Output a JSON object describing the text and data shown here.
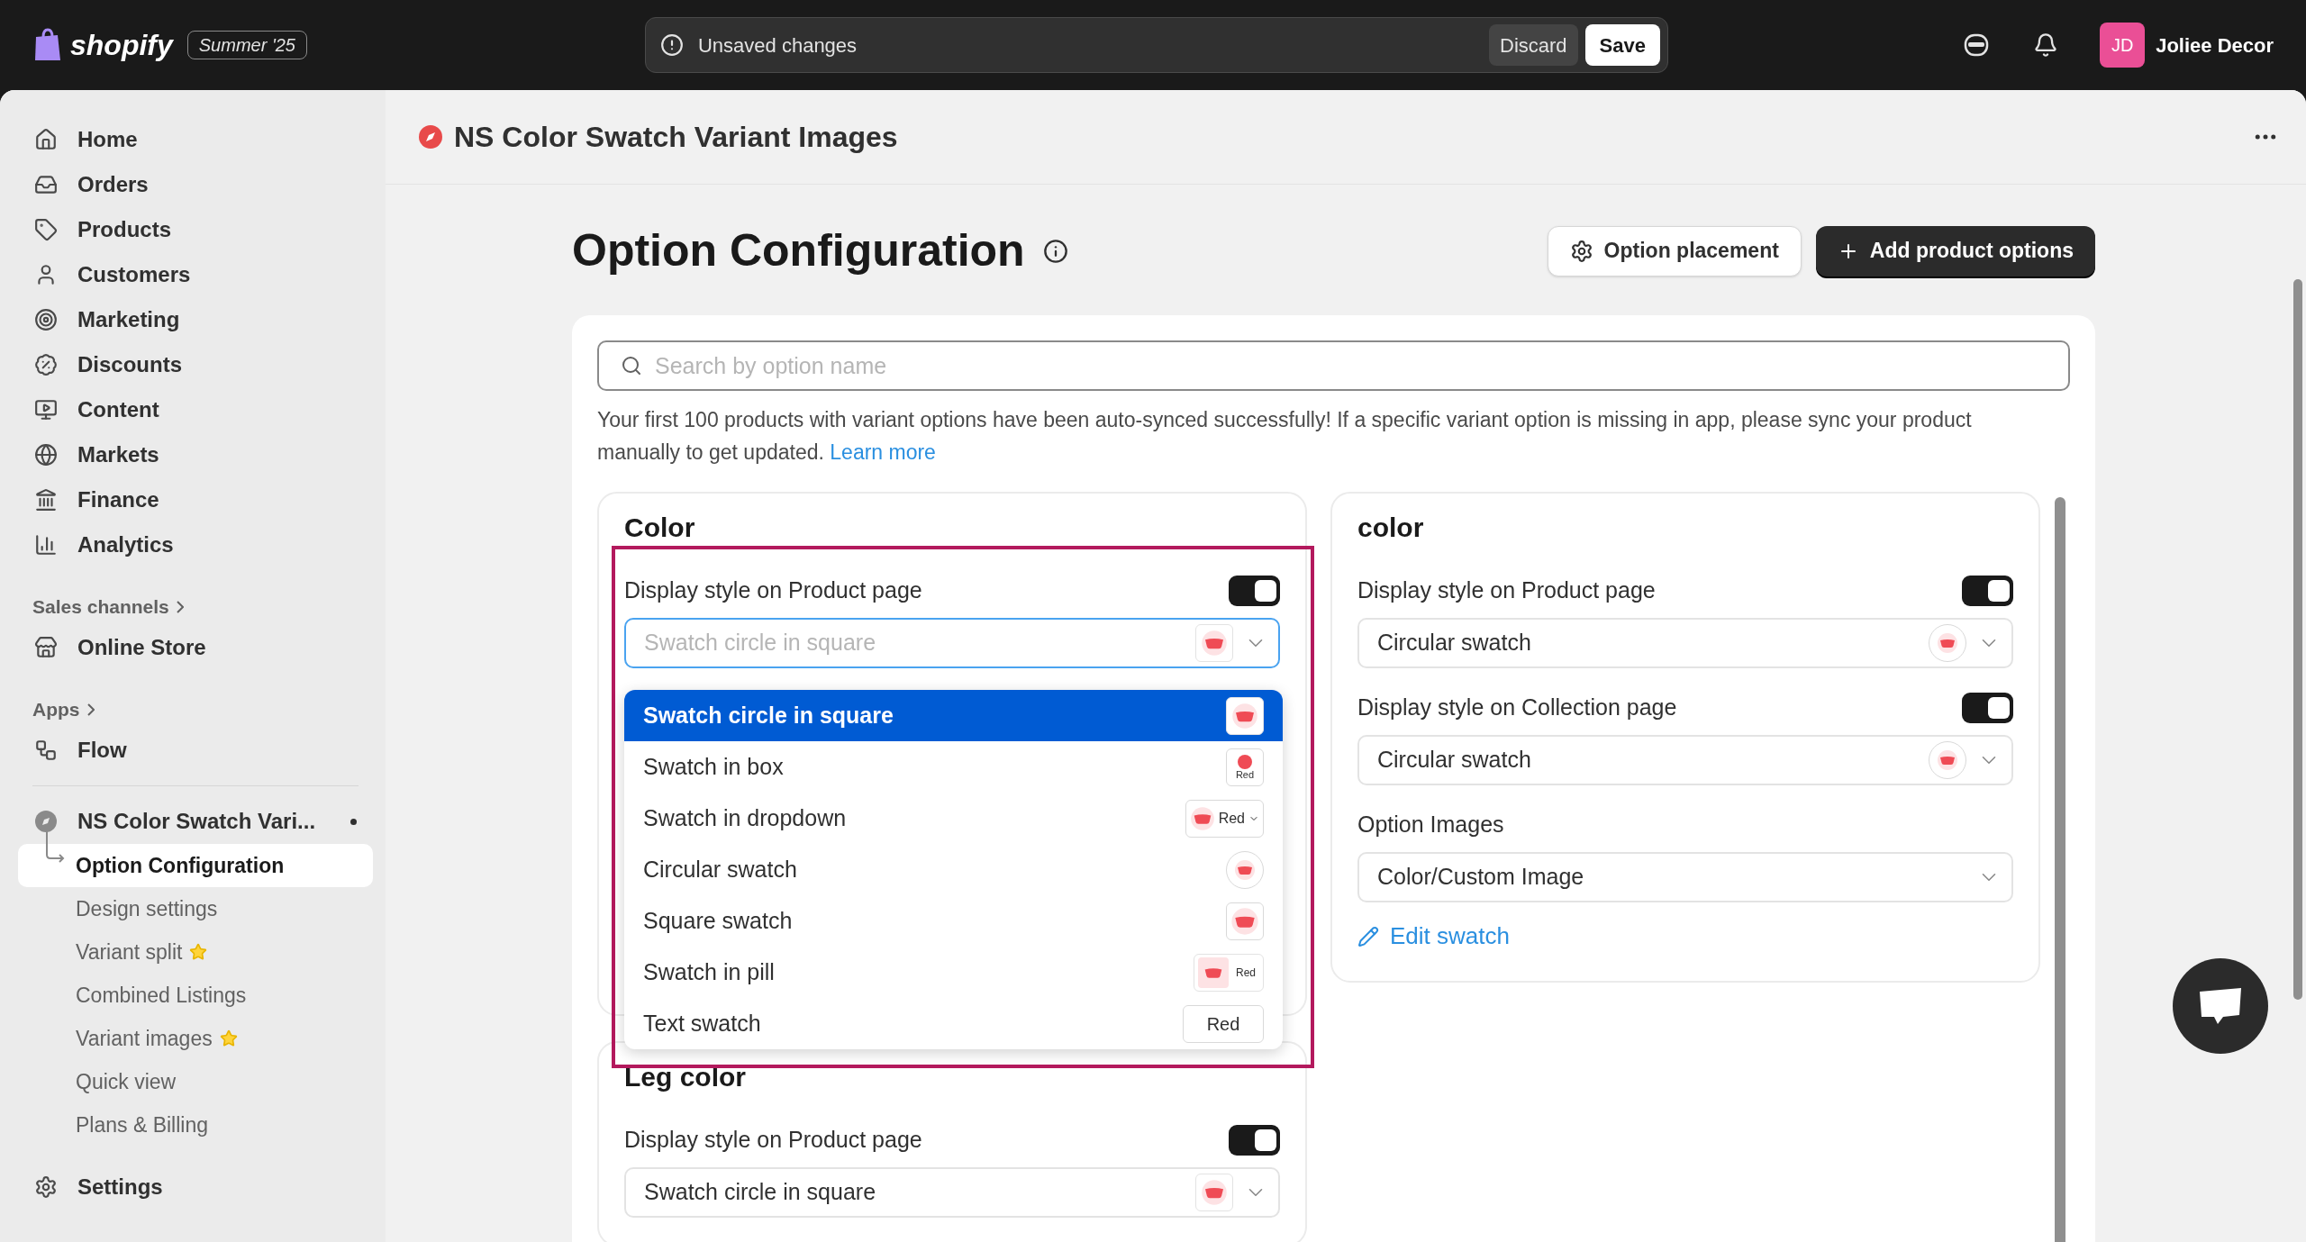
{
  "topbar": {
    "brand": "shopify",
    "edition": "Summer '25",
    "notice": "Unsaved changes",
    "discard": "Discard",
    "save": "Save",
    "user": {
      "initials": "JD",
      "name": "Joliee Decor"
    }
  },
  "sidebar": {
    "main": [
      "Home",
      "Orders",
      "Products",
      "Customers",
      "Marketing",
      "Discounts",
      "Content",
      "Markets",
      "Finance",
      "Analytics"
    ],
    "sales_channels": {
      "heading": "Sales channels",
      "items": [
        "Online Store"
      ]
    },
    "apps": {
      "heading": "Apps",
      "items": [
        "Flow"
      ]
    },
    "app": {
      "name": "NS Color Swatch Vari...",
      "pages": [
        {
          "label": "Option Configuration",
          "selected": true,
          "starred": false
        },
        {
          "label": "Design settings",
          "selected": false,
          "starred": false
        },
        {
          "label": "Variant split",
          "selected": false,
          "starred": true
        },
        {
          "label": "Combined Listings",
          "selected": false,
          "starred": false
        },
        {
          "label": "Variant images",
          "selected": false,
          "starred": true
        },
        {
          "label": "Quick view",
          "selected": false,
          "starred": false
        },
        {
          "label": "Plans & Billing",
          "selected": false,
          "starred": false
        }
      ]
    },
    "settings": "Settings"
  },
  "app_header": {
    "title": "NS Color Swatch Variant Images"
  },
  "page": {
    "title": "Option Configuration",
    "buttons": [
      {
        "label": "Option placement",
        "kind": "secondary"
      },
      {
        "label": "Add product options",
        "kind": "primary"
      }
    ],
    "search": {
      "placeholder": "Search by option name"
    },
    "notice": {
      "text": "Your first 100 products with variant options have been auto-synced successfully! If a specific variant option is missing in app, please sync your product manually to get updated.",
      "link": "Learn more"
    },
    "columns": [
      [
        {
          "title": "Color",
          "settings": [
            {
              "kind": "toggle-select",
              "label": "Display style on Product page",
              "on": true,
              "select": {
                "value": "Swatch circle in square",
                "preview": {
                  "kind": "circle-in-square"
                },
                "focused": true
              }
            }
          ],
          "dropdown": {
            "options": [
              {
                "label": "Swatch circle in square",
                "selected": true,
                "preview": {
                  "kind": "circle-in-square"
                }
              },
              {
                "label": "Swatch in box",
                "selected": false,
                "preview": {
                  "kind": "box",
                  "text": "Red"
                }
              },
              {
                "label": "Swatch in dropdown",
                "selected": false,
                "preview": {
                  "kind": "dropdown",
                  "text": "Red"
                }
              },
              {
                "label": "Circular swatch",
                "selected": false,
                "preview": {
                  "kind": "circle"
                }
              },
              {
                "label": "Square swatch",
                "selected": false,
                "preview": {
                  "kind": "square"
                }
              },
              {
                "label": "Swatch in pill",
                "selected": false,
                "preview": {
                  "kind": "pill",
                  "text": "Red"
                }
              },
              {
                "label": "Text swatch",
                "selected": false,
                "preview": {
                  "kind": "text",
                  "text": "Red"
                }
              }
            ]
          }
        },
        {
          "title": "Leg color",
          "settings": [
            {
              "kind": "toggle-select",
              "label": "Display style on Product page",
              "on": true,
              "select": {
                "value": "Swatch circle in square",
                "preview": {
                  "kind": "circle-in-square"
                },
                "focused": false
              }
            }
          ]
        }
      ],
      [
        {
          "title": "color",
          "settings": [
            {
              "kind": "toggle-select",
              "label": "Display style on Product page",
              "on": true,
              "select": {
                "value": "Circular swatch",
                "preview": {
                  "kind": "circle"
                },
                "focused": false
              }
            },
            {
              "kind": "toggle-select",
              "label": "Display style on Collection page",
              "on": true,
              "select": {
                "value": "Circular swatch",
                "preview": {
                  "kind": "circle"
                },
                "focused": false
              }
            },
            {
              "kind": "select",
              "label": "Option Images",
              "select": {
                "value": "Color/Custom Image",
                "focused": false
              }
            }
          ],
          "link": "Edit swatch"
        }
      ]
    ]
  }
}
